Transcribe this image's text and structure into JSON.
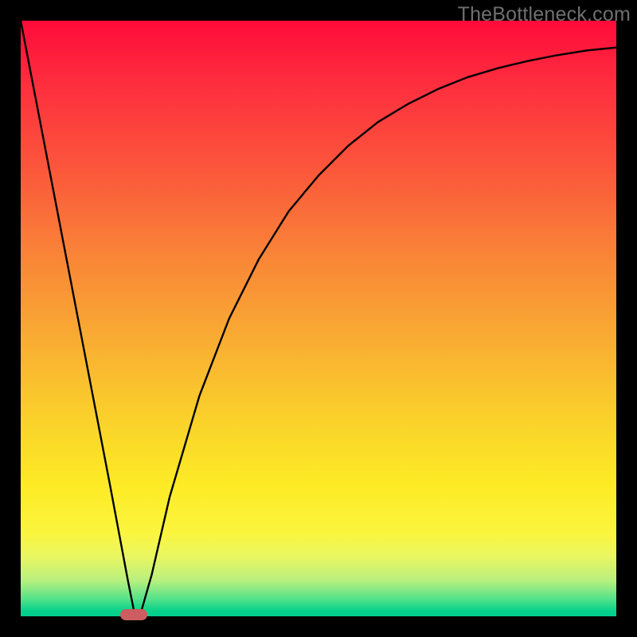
{
  "watermark": "TheBottleneck.com",
  "chart_data": {
    "type": "line",
    "title": "",
    "xlabel": "",
    "ylabel": "",
    "xlim": [
      0,
      100
    ],
    "ylim": [
      0,
      100
    ],
    "grid": false,
    "series": [
      {
        "name": "bottleneck-curve",
        "x": [
          0,
          5,
          10,
          15,
          18,
          19,
          20,
          22,
          25,
          30,
          35,
          40,
          45,
          50,
          55,
          60,
          65,
          70,
          75,
          80,
          85,
          90,
          95,
          100
        ],
        "y": [
          100,
          74,
          48,
          22,
          6,
          1,
          0,
          7,
          20,
          37,
          50,
          60,
          68,
          74,
          79,
          83,
          86,
          88.5,
          90.5,
          92,
          93.2,
          94.2,
          95,
          95.5
        ]
      }
    ],
    "marker": {
      "name": "bottleneck-marker",
      "x": 19,
      "y": 0,
      "color": "#cd5d60"
    },
    "background_gradient": {
      "top": "#ff0b3a",
      "mid1": "#f9b331",
      "mid2": "#fdeb25",
      "bottom": "#00cf8e"
    }
  }
}
